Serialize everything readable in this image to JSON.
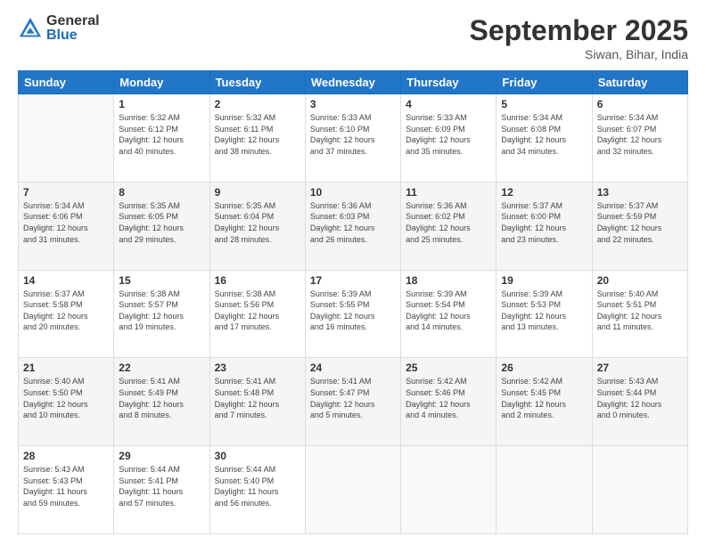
{
  "logo": {
    "general": "General",
    "blue": "Blue"
  },
  "header": {
    "month": "September 2025",
    "location": "Siwan, Bihar, India"
  },
  "days_of_week": [
    "Sunday",
    "Monday",
    "Tuesday",
    "Wednesday",
    "Thursday",
    "Friday",
    "Saturday"
  ],
  "weeks": [
    [
      {
        "day": "",
        "info": ""
      },
      {
        "day": "1",
        "info": "Sunrise: 5:32 AM\nSunset: 6:12 PM\nDaylight: 12 hours\nand 40 minutes."
      },
      {
        "day": "2",
        "info": "Sunrise: 5:32 AM\nSunset: 6:11 PM\nDaylight: 12 hours\nand 38 minutes."
      },
      {
        "day": "3",
        "info": "Sunrise: 5:33 AM\nSunset: 6:10 PM\nDaylight: 12 hours\nand 37 minutes."
      },
      {
        "day": "4",
        "info": "Sunrise: 5:33 AM\nSunset: 6:09 PM\nDaylight: 12 hours\nand 35 minutes."
      },
      {
        "day": "5",
        "info": "Sunrise: 5:34 AM\nSunset: 6:08 PM\nDaylight: 12 hours\nand 34 minutes."
      },
      {
        "day": "6",
        "info": "Sunrise: 5:34 AM\nSunset: 6:07 PM\nDaylight: 12 hours\nand 32 minutes."
      }
    ],
    [
      {
        "day": "7",
        "info": "Sunrise: 5:34 AM\nSunset: 6:06 PM\nDaylight: 12 hours\nand 31 minutes."
      },
      {
        "day": "8",
        "info": "Sunrise: 5:35 AM\nSunset: 6:05 PM\nDaylight: 12 hours\nand 29 minutes."
      },
      {
        "day": "9",
        "info": "Sunrise: 5:35 AM\nSunset: 6:04 PM\nDaylight: 12 hours\nand 28 minutes."
      },
      {
        "day": "10",
        "info": "Sunrise: 5:36 AM\nSunset: 6:03 PM\nDaylight: 12 hours\nand 26 minutes."
      },
      {
        "day": "11",
        "info": "Sunrise: 5:36 AM\nSunset: 6:02 PM\nDaylight: 12 hours\nand 25 minutes."
      },
      {
        "day": "12",
        "info": "Sunrise: 5:37 AM\nSunset: 6:00 PM\nDaylight: 12 hours\nand 23 minutes."
      },
      {
        "day": "13",
        "info": "Sunrise: 5:37 AM\nSunset: 5:59 PM\nDaylight: 12 hours\nand 22 minutes."
      }
    ],
    [
      {
        "day": "14",
        "info": "Sunrise: 5:37 AM\nSunset: 5:58 PM\nDaylight: 12 hours\nand 20 minutes."
      },
      {
        "day": "15",
        "info": "Sunrise: 5:38 AM\nSunset: 5:57 PM\nDaylight: 12 hours\nand 19 minutes."
      },
      {
        "day": "16",
        "info": "Sunrise: 5:38 AM\nSunset: 5:56 PM\nDaylight: 12 hours\nand 17 minutes."
      },
      {
        "day": "17",
        "info": "Sunrise: 5:39 AM\nSunset: 5:55 PM\nDaylight: 12 hours\nand 16 minutes."
      },
      {
        "day": "18",
        "info": "Sunrise: 5:39 AM\nSunset: 5:54 PM\nDaylight: 12 hours\nand 14 minutes."
      },
      {
        "day": "19",
        "info": "Sunrise: 5:39 AM\nSunset: 5:53 PM\nDaylight: 12 hours\nand 13 minutes."
      },
      {
        "day": "20",
        "info": "Sunrise: 5:40 AM\nSunset: 5:51 PM\nDaylight: 12 hours\nand 11 minutes."
      }
    ],
    [
      {
        "day": "21",
        "info": "Sunrise: 5:40 AM\nSunset: 5:50 PM\nDaylight: 12 hours\nand 10 minutes."
      },
      {
        "day": "22",
        "info": "Sunrise: 5:41 AM\nSunset: 5:49 PM\nDaylight: 12 hours\nand 8 minutes."
      },
      {
        "day": "23",
        "info": "Sunrise: 5:41 AM\nSunset: 5:48 PM\nDaylight: 12 hours\nand 7 minutes."
      },
      {
        "day": "24",
        "info": "Sunrise: 5:41 AM\nSunset: 5:47 PM\nDaylight: 12 hours\nand 5 minutes."
      },
      {
        "day": "25",
        "info": "Sunrise: 5:42 AM\nSunset: 5:46 PM\nDaylight: 12 hours\nand 4 minutes."
      },
      {
        "day": "26",
        "info": "Sunrise: 5:42 AM\nSunset: 5:45 PM\nDaylight: 12 hours\nand 2 minutes."
      },
      {
        "day": "27",
        "info": "Sunrise: 5:43 AM\nSunset: 5:44 PM\nDaylight: 12 hours\nand 0 minutes."
      }
    ],
    [
      {
        "day": "28",
        "info": "Sunrise: 5:43 AM\nSunset: 5:43 PM\nDaylight: 11 hours\nand 59 minutes."
      },
      {
        "day": "29",
        "info": "Sunrise: 5:44 AM\nSunset: 5:41 PM\nDaylight: 11 hours\nand 57 minutes."
      },
      {
        "day": "30",
        "info": "Sunrise: 5:44 AM\nSunset: 5:40 PM\nDaylight: 11 hours\nand 56 minutes."
      },
      {
        "day": "",
        "info": ""
      },
      {
        "day": "",
        "info": ""
      },
      {
        "day": "",
        "info": ""
      },
      {
        "day": "",
        "info": ""
      }
    ]
  ]
}
